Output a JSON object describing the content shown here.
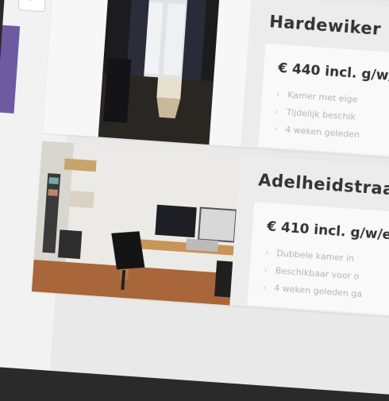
{
  "listings": [
    {
      "title": "Hardewiker",
      "price": "€ 440 incl. g/w/",
      "bullets": [
        "Kamer met eige",
        "Tijdelijk beschik",
        "4 weken geleden"
      ]
    },
    {
      "title": "Adelheidstraa",
      "price": "€ 410 incl. g/w/e",
      "bullets": [
        "Dubbele kamer in ",
        "Beschikbaar voor o",
        "4 weken geleden ga"
      ]
    }
  ]
}
